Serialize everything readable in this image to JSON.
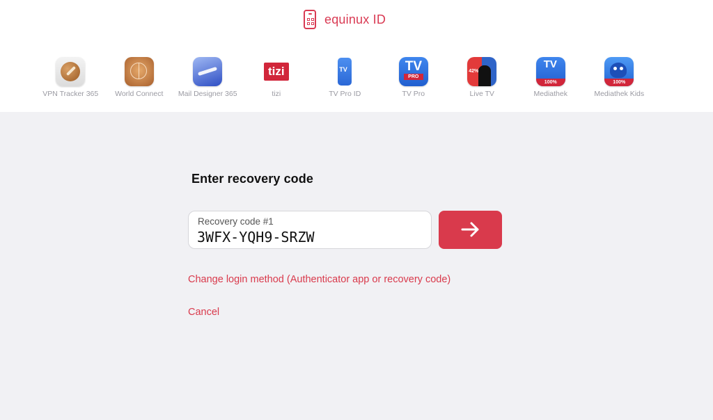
{
  "brand": {
    "name": "equinux ID",
    "accent": "#d93a4c"
  },
  "apps": [
    {
      "label": "VPN Tracker 365",
      "icon": "vpn-tracker-icon"
    },
    {
      "label": "World Connect",
      "icon": "world-connect-icon"
    },
    {
      "label": "Mail Designer 365",
      "icon": "mail-designer-icon"
    },
    {
      "label": "tizi",
      "icon": "tizi-icon",
      "icon_text": "tizi"
    },
    {
      "label": "TV Pro ID",
      "icon": "tv-pro-id-icon",
      "icon_text": "TV"
    },
    {
      "label": "TV Pro",
      "icon": "tv-pro-icon",
      "icon_text": "TV",
      "badge": "PRO"
    },
    {
      "label": "Live TV",
      "icon": "live-tv-icon",
      "icon_text": "42%"
    },
    {
      "label": "Mediathek",
      "icon": "mediathek-icon",
      "icon_text": "TV",
      "badge": "100%"
    },
    {
      "label": "Mediathek Kids",
      "icon": "mediathek-kids-icon",
      "badge": "100%"
    }
  ],
  "form": {
    "heading": "Enter recovery code",
    "field_label": "Recovery code #1",
    "field_value": "3WFX-YQH9-SRZW",
    "submit_icon": "arrow-right-icon"
  },
  "links": {
    "change_method": "Change login method (Authenticator app or recovery code)",
    "cancel": "Cancel"
  }
}
